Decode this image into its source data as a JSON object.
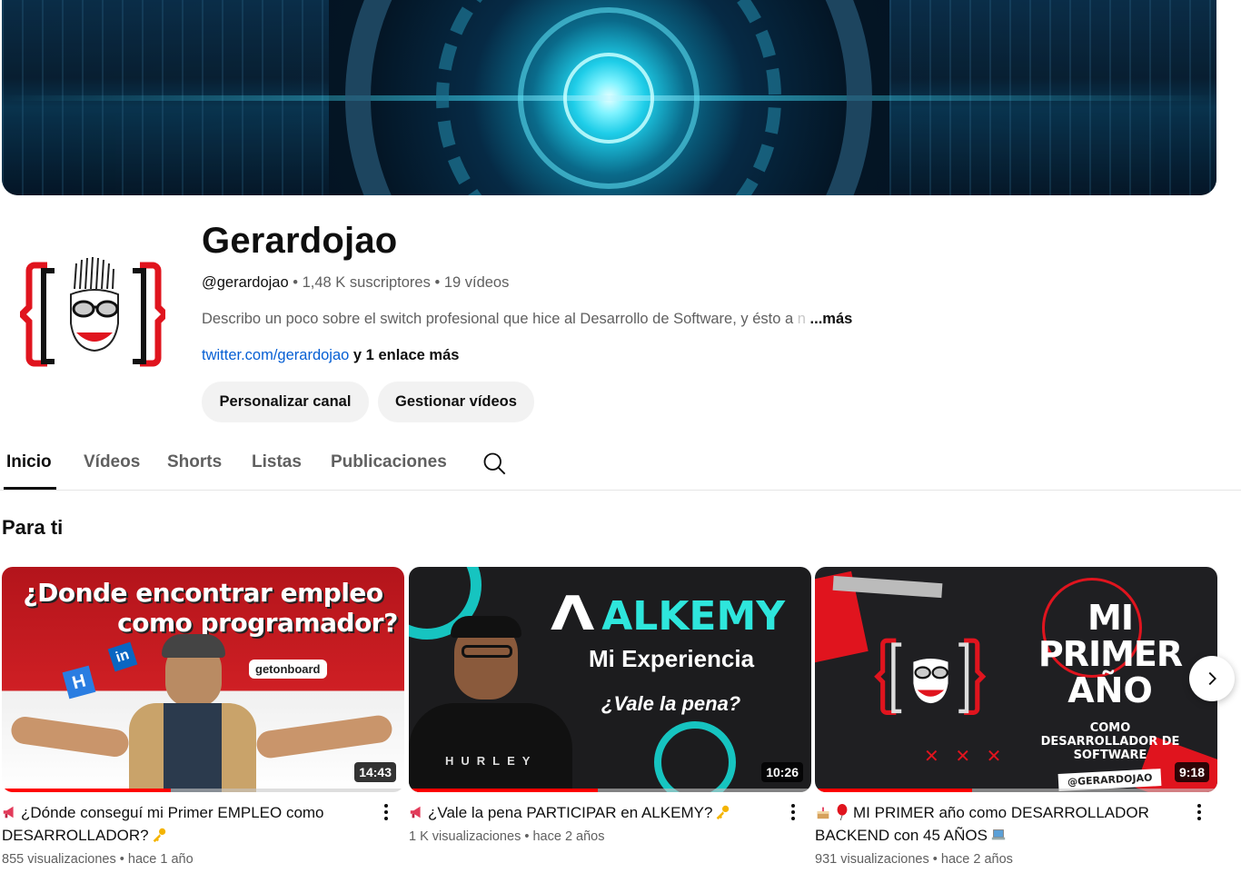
{
  "channel": {
    "name": "Gerardojao",
    "handle": "@gerardojao",
    "subscribers": "1,48 K suscriptores",
    "videos_count": "19 vídeos",
    "description": "Describo un poco sobre el switch profesional que hice al Desarrollo de Software, y ésto a",
    "description_fade": " n",
    "more_label": "...más",
    "link": "twitter.com/gerardojao",
    "extra_links": "y 1 enlace más"
  },
  "actions": {
    "customize": "Personalizar canal",
    "manage": "Gestionar vídeos"
  },
  "tabs": [
    {
      "label": "Inicio",
      "active": true
    },
    {
      "label": "Vídeos"
    },
    {
      "label": "Shorts"
    },
    {
      "label": "Listas"
    },
    {
      "label": "Publicaciones"
    }
  ],
  "section": {
    "title": "Para ti"
  },
  "videos": [
    {
      "title": "¿Dónde conseguí mi Primer EMPLEO como DESARROLLADOR?",
      "views": "855 visualizaciones",
      "age": "hace 1 año",
      "duration": "14:43",
      "thumb": {
        "line1": "¿Donde encontrar empleo",
        "line2": "como programador?",
        "badge": "getonboard"
      },
      "progress": 0.42
    },
    {
      "title": "¿Vale la pena PARTICIPAR en ALKEMY?",
      "views": "1 K visualizaciones",
      "age": "hace 2 años",
      "duration": "10:26",
      "thumb": {
        "brand": "ALKEMY",
        "line1": "Mi Experiencia",
        "line2": "¿Vale la pena?",
        "shirt": "HURLEY"
      },
      "progress": 0.47
    },
    {
      "title": "MI PRIMER año como DESARROLLADOR BACKEND con 45 AÑOS",
      "views": "931 visualizaciones",
      "age": "hace 2 años",
      "duration": "9:18",
      "thumb": {
        "line1": "MI PRIMER",
        "line2": "AÑO",
        "line3": "COMO",
        "line4": "DESARROLLADOR DE",
        "line5": "SOFTWARE",
        "tag": "@GERARDOJAO",
        "xs": "✕ ✕ ✕"
      },
      "progress": 0.39
    }
  ],
  "separator": "•",
  "colors": {
    "link": "#065fd4",
    "progress": "#ff0000",
    "muted": "#606060"
  }
}
